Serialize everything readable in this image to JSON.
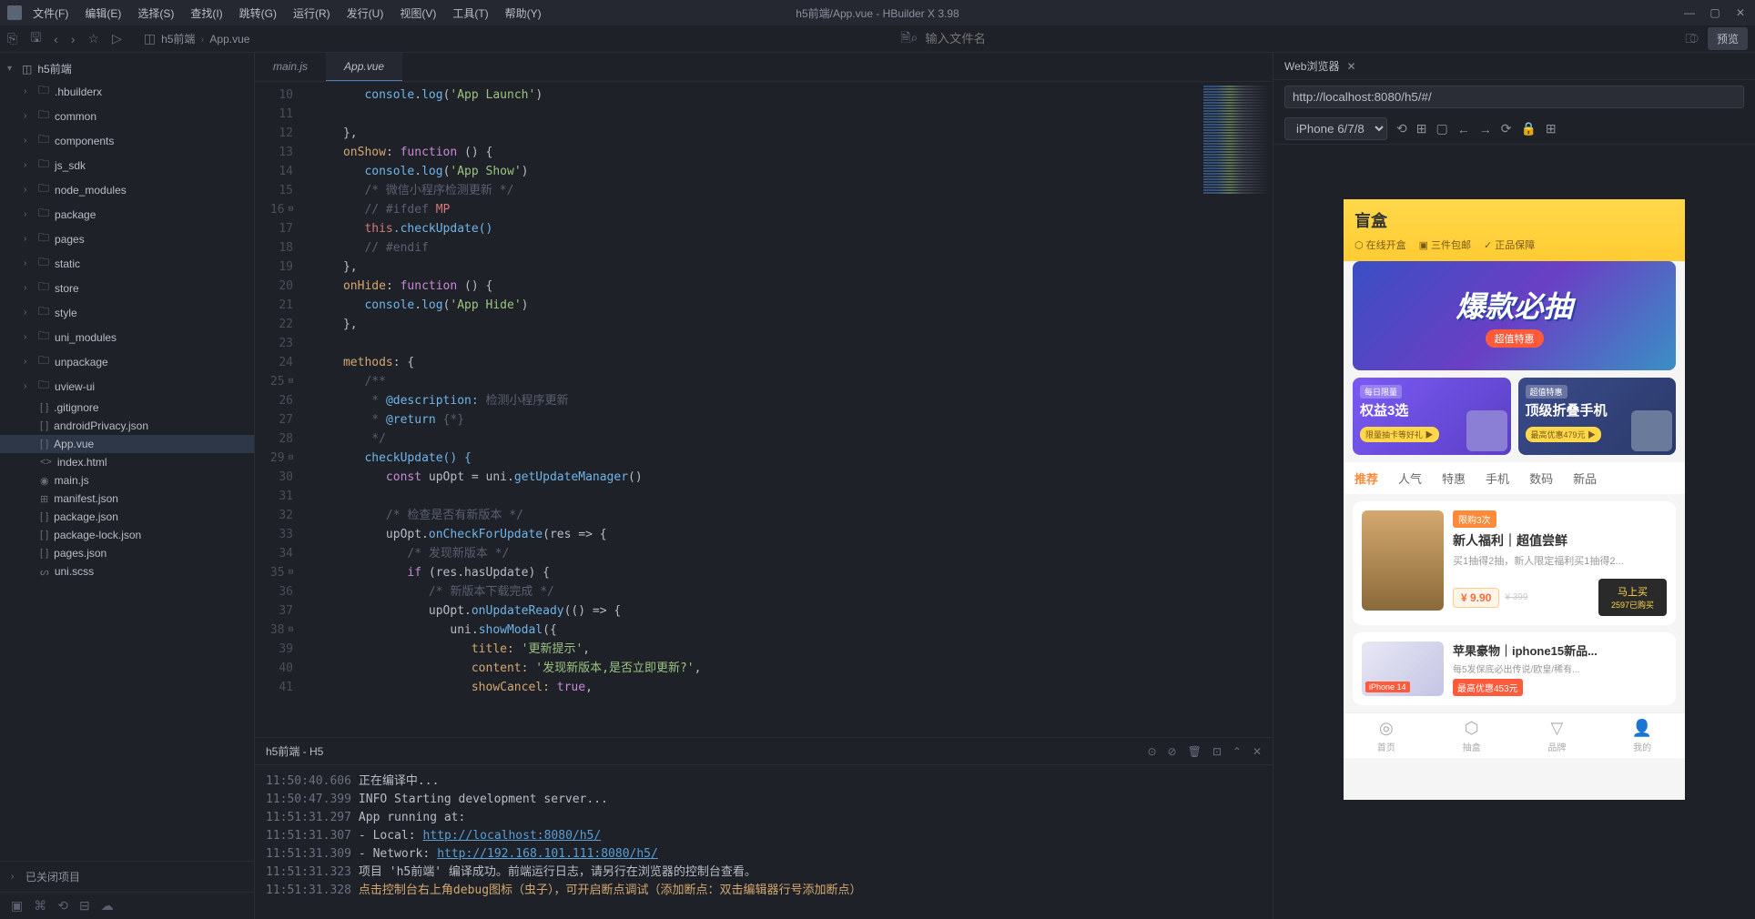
{
  "titlebar": {
    "menus": [
      "文件(F)",
      "编辑(E)",
      "选择(S)",
      "查找(I)",
      "跳转(G)",
      "运行(R)",
      "发行(U)",
      "视图(V)",
      "工具(T)",
      "帮助(Y)"
    ],
    "title": "h5前端/App.vue - HBuilder X 3.98"
  },
  "toolbar": {
    "breadcrumb": [
      "h5前端",
      "App.vue"
    ],
    "filename_placeholder": "输入文件名",
    "preview_label": "预览"
  },
  "tree": {
    "root": "h5前端",
    "folders": [
      ".hbuilderx",
      "common",
      "components",
      "js_sdk",
      "node_modules",
      "package",
      "pages",
      "static",
      "store",
      "style",
      "uni_modules",
      "unpackage",
      "uview-ui"
    ],
    "files": [
      {
        "name": ".gitignore",
        "icon": "[ ]"
      },
      {
        "name": "androidPrivacy.json",
        "icon": "[ ]"
      },
      {
        "name": "App.vue",
        "icon": "[ ]",
        "active": true
      },
      {
        "name": "index.html",
        "icon": "<>"
      },
      {
        "name": "main.js",
        "icon": "◉"
      },
      {
        "name": "manifest.json",
        "icon": "⊞"
      },
      {
        "name": "package.json",
        "icon": "[ ]"
      },
      {
        "name": "package-lock.json",
        "icon": "[ ]"
      },
      {
        "name": "pages.json",
        "icon": "[ ]"
      },
      {
        "name": "uni.scss",
        "icon": "ᔕ"
      }
    ],
    "closed_projects": "已关闭项目"
  },
  "tabs": [
    {
      "label": "main.js",
      "active": false
    },
    {
      "label": "App.vue",
      "active": true
    }
  ],
  "code_lines": [
    10,
    11,
    12,
    13,
    14,
    15,
    16,
    17,
    18,
    19,
    20,
    21,
    22,
    23,
    24,
    25,
    26,
    27,
    28,
    29,
    30,
    31,
    32,
    33,
    34,
    35,
    36,
    37,
    38,
    39,
    40,
    41
  ],
  "code": {
    "l10": "console.log('App Launch')",
    "l12": "},",
    "l13_a": "onShow",
    "l13_b": "function",
    "l13_c": "() {",
    "l14": "console.log('App Show')",
    "l15": "/* 微信小程序检测更新 */",
    "l16": "// #ifdef",
    "l16_b": "MP",
    "l17_a": "this",
    "l17_b": ".checkUpdate()",
    "l18": "// #endif",
    "l19": "},",
    "l20_a": "onHide",
    "l20_b": "function",
    "l20_c": "() {",
    "l21": "console.log('App Hide')",
    "l22": "},",
    "l24_a": "methods",
    "l24_b": ": {",
    "l25": "/**",
    "l26_a": " * ",
    "l26_b": "@description:",
    "l26_c": " 检测小程序更新",
    "l27_a": " * ",
    "l27_b": "@return",
    "l27_c": " {*}",
    "l28": " */",
    "l29": "checkUpdate() {",
    "l30_a": "const",
    "l30_b": " upOpt = uni.",
    "l30_c": "getUpdateManager",
    "l30_d": "()",
    "l32": "/* 检查是否有新版本 */",
    "l33_a": "upOpt.",
    "l33_b": "onCheckForUpdate",
    "l33_c": "(res => {",
    "l34": "/* 发现新版本 */",
    "l35_a": "if",
    "l35_b": " (res.hasUpdate) {",
    "l36": "/* 新版本下载完成 */",
    "l37_a": "upOpt.",
    "l37_b": "onUpdateReady",
    "l37_c": "(() => {",
    "l38_a": "uni.",
    "l38_b": "showModal",
    "l38_c": "({",
    "l39_a": "title: ",
    "l39_b": "'更新提示'",
    "l39_c": ",",
    "l40_a": "content: ",
    "l40_b": "'发现新版本,是否立即更新?'",
    "l40_c": ",",
    "l41_a": "showCancel: ",
    "l41_b": "true",
    "l41_c": ","
  },
  "console": {
    "title": "h5前端 - H5",
    "logs": [
      {
        "time": "11:50:40.606",
        "text": "正在编译中..."
      },
      {
        "time": "11:50:47.399",
        "text": "  INFO  Starting development server..."
      },
      {
        "time": "11:51:31.297",
        "text": "  App running at:"
      },
      {
        "time": "11:51:31.307",
        "text": "  - Local:   ",
        "link": "http://localhost:8080/h5/"
      },
      {
        "time": "11:51:31.309",
        "text": "  - Network: ",
        "link": "http://192.168.101.111:8080/h5/"
      },
      {
        "time": "11:51:31.323",
        "text": "项目 'h5前端' 编译成功。前端运行日志，请另行在浏览器的控制台查看。"
      },
      {
        "time": "11:51:31.328",
        "warn": "点击控制台右上角debug图标（虫子），可开启断点调试（添加断点：双击编辑器行号添加断点）"
      }
    ]
  },
  "preview": {
    "title": "Web浏览器",
    "url": "http://localhost:8080/h5/#/",
    "device": "iPhone 6/7/8"
  },
  "app": {
    "brand": "盲盒",
    "features": [
      "在线开盒",
      "三件包邮",
      "正品保障"
    ],
    "banner_text": "爆款必抽",
    "banner_badge": "超值特惠",
    "promos": [
      {
        "tag": "每日限量",
        "title": "权益3选",
        "btn": "限量抽卡等好礼 ▶"
      },
      {
        "tag": "超值特惠",
        "title": "顶级折叠手机",
        "btn": "最高优惠479元 ▶"
      }
    ],
    "categories": [
      "推荐",
      "人气",
      "特惠",
      "手机",
      "数码",
      "新品"
    ],
    "product1": {
      "badge": "限购3次",
      "title": "新人福利｜超值尝鲜",
      "desc": "买1抽得2抽，新人限定福利买1抽得2...",
      "price": "¥ 9.90",
      "oldprice": "¥ 399",
      "buy": "马上买",
      "sold": "2597已购买"
    },
    "product2": {
      "img_label": "iPhone 14",
      "title": "苹果豪物｜iphone15新品...",
      "desc": "每5发保底必出传说/欧皇/稀有...",
      "discount": "最高优惠453元"
    },
    "nav": [
      "首页",
      "抽盒",
      "品牌",
      "我的"
    ]
  }
}
